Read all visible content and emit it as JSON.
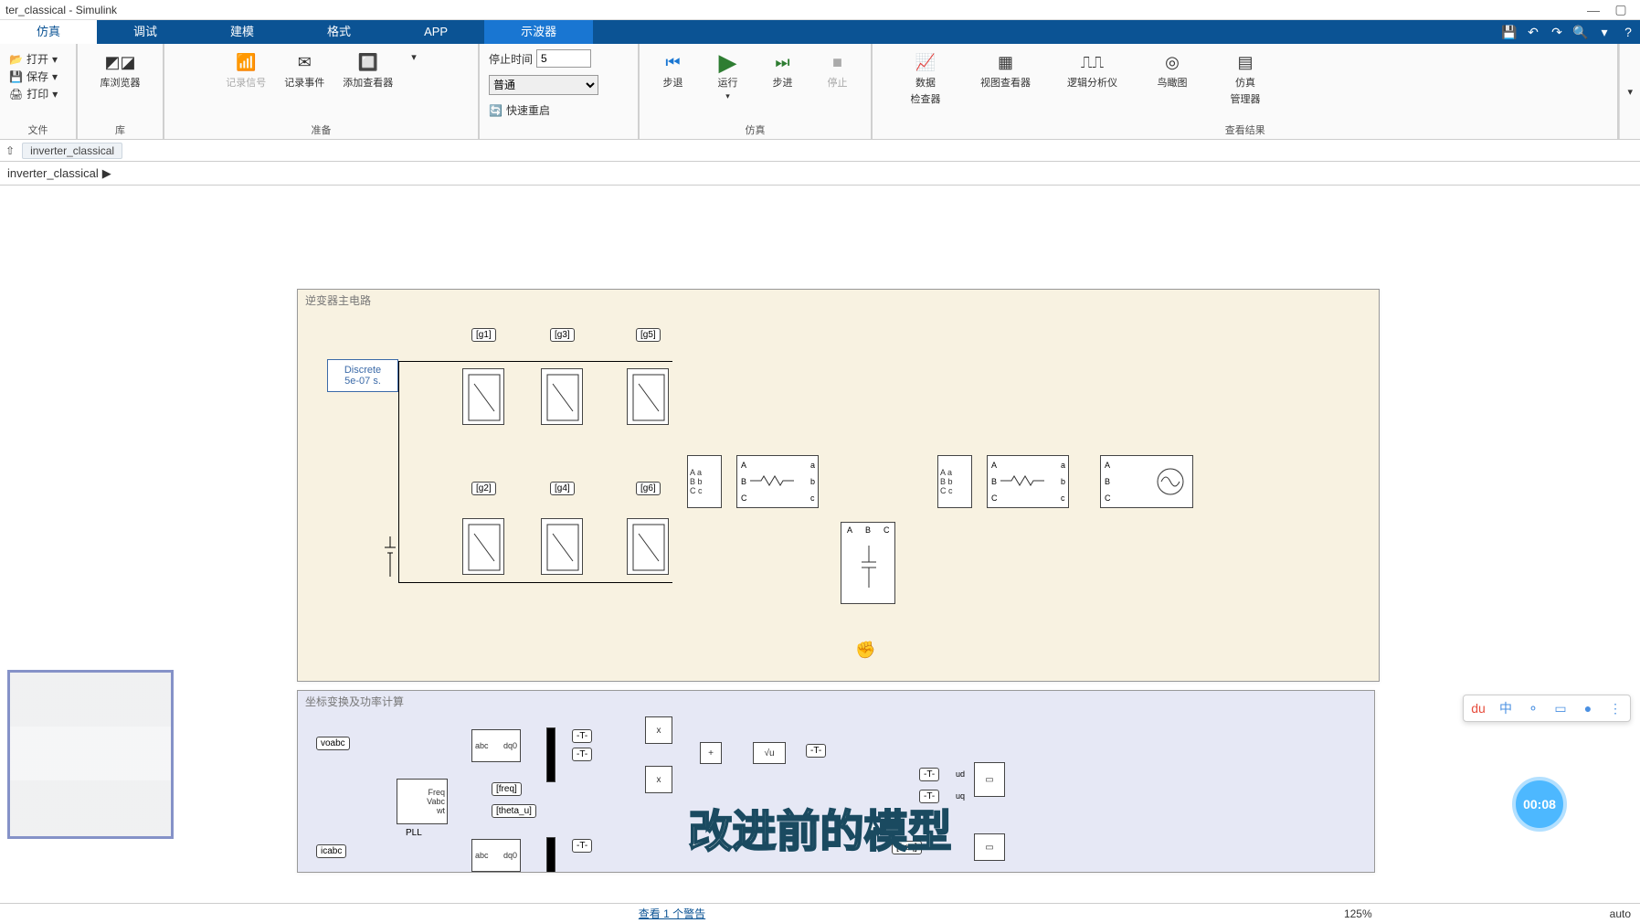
{
  "title_bar": {
    "text": "ter_classical - Simulink"
  },
  "tabs": {
    "items": [
      "仿真",
      "调试",
      "建模",
      "格式",
      "APP",
      "示波器"
    ],
    "active_index": 0,
    "highlight_index": 5
  },
  "ribbon": {
    "file": {
      "open": "打开",
      "save": "保存",
      "print": "打印",
      "group_label": "文件"
    },
    "library": {
      "browser": "库浏览器",
      "group_label": "库"
    },
    "prepare": {
      "log_signal": "记录信号",
      "log_event": "记录事件",
      "add_viewer": "添加查看器",
      "group_label": "准备"
    },
    "simulation": {
      "stop_time_label": "停止时间",
      "stop_time_value": "5",
      "mode_options": [
        "普通"
      ],
      "mode_selected": "普通",
      "fast_restart": "快速重启",
      "step_back": "步退",
      "run": "运行",
      "step_forward": "步进",
      "stop": "停止",
      "group_label": "仿真"
    },
    "review": {
      "data_inspector_l1": "数据",
      "data_inspector_l2": "检查器",
      "view_viewer": "视图查看器",
      "logic_analyzer": "逻辑分析仪",
      "bird_eye": "鸟瞰图",
      "sim_manager_l1": "仿真",
      "sim_manager_l2": "管理器",
      "group_label": "查看结果"
    }
  },
  "path_bar": {
    "chip": "inverter_classical"
  },
  "model_path": {
    "root": "inverter_classical"
  },
  "canvas": {
    "area1_title": "逆变器主电路",
    "area2_title": "坐标变换及功率计算",
    "powergui_l1": "Discrete",
    "powergui_l2": "5e-07 s.",
    "gate_tags": [
      "[g1]",
      "[g3]",
      "[g5]",
      "[g2]",
      "[g4]",
      "[g6]"
    ],
    "block2": {
      "voabc": "voabc",
      "icabc": "icabc",
      "abc": "abc",
      "dq0": "dq0",
      "wt": "wt",
      "freq_label": "Freq",
      "vabc_label": "Vabc",
      "pll": "PLL",
      "freq_tag": "[freq]",
      "theta_tag": "[theta_u]",
      "x": "x",
      "sqrt": "√u",
      "T": "-T-",
      "ud": "ud",
      "uq": "uq"
    }
  },
  "subtitle": "改进前的模型",
  "timer": "00:08",
  "ime_items": [
    "du",
    "中",
    "⚬",
    "▭",
    "●",
    "⋮"
  ],
  "status": {
    "warning": "查看 1 个警告",
    "zoom": "125%",
    "mode": "auto"
  }
}
